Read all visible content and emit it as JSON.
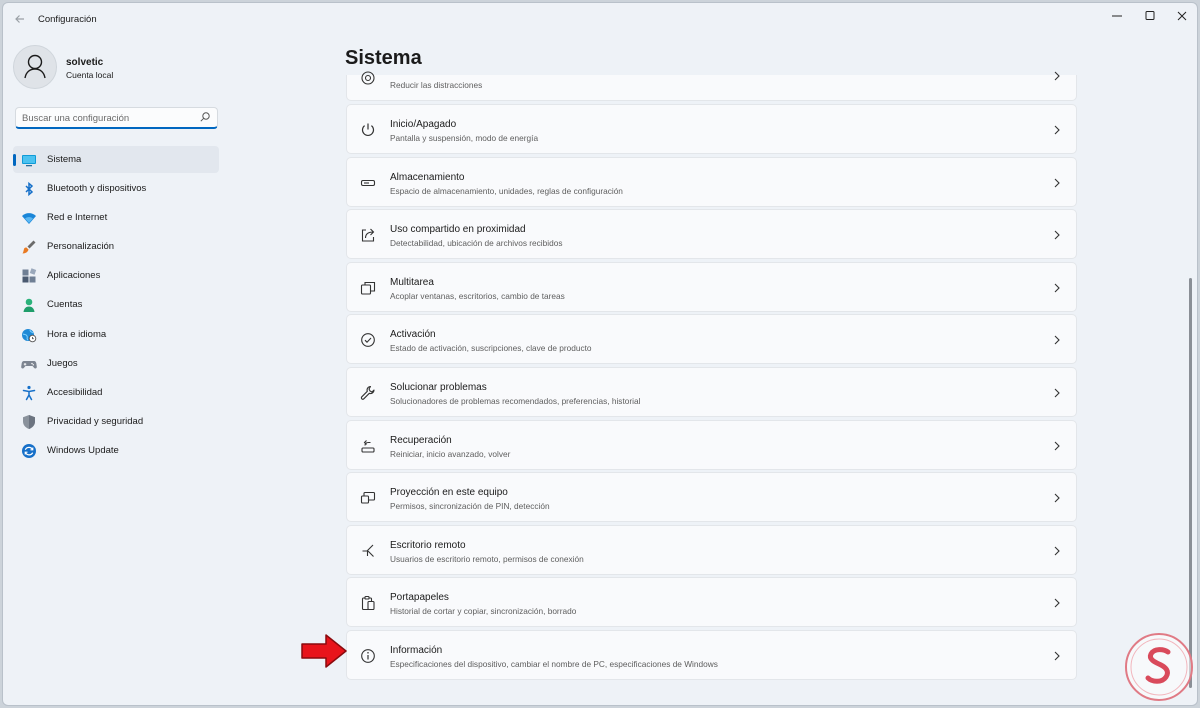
{
  "window": {
    "title": "Configuración"
  },
  "profile": {
    "name": "solvetic",
    "account_type": "Cuenta local"
  },
  "search": {
    "placeholder": "Buscar una configuración"
  },
  "sidebar": {
    "items": [
      {
        "label": "Sistema",
        "icon": "monitor-icon",
        "selected": true
      },
      {
        "label": "Bluetooth y dispositivos",
        "icon": "bluetooth-icon"
      },
      {
        "label": "Red e Internet",
        "icon": "wifi-icon"
      },
      {
        "label": "Personalización",
        "icon": "brush-icon"
      },
      {
        "label": "Aplicaciones",
        "icon": "apps-icon"
      },
      {
        "label": "Cuentas",
        "icon": "person-icon"
      },
      {
        "label": "Hora e idioma",
        "icon": "globe-clock-icon"
      },
      {
        "label": "Juegos",
        "icon": "gamepad-icon"
      },
      {
        "label": "Accesibilidad",
        "icon": "accessibility-icon"
      },
      {
        "label": "Privacidad y seguridad",
        "icon": "shield-icon"
      },
      {
        "label": "Windows Update",
        "icon": "update-icon"
      }
    ]
  },
  "main": {
    "title": "Sistema",
    "partial_item": {
      "subtitle": "Reducir las distracciones",
      "icon": "focus-icon"
    },
    "items": [
      {
        "title": "Inicio/Apagado",
        "subtitle": "Pantalla y suspensión, modo de energía",
        "icon": "power-icon"
      },
      {
        "title": "Almacenamiento",
        "subtitle": "Espacio de almacenamiento, unidades, reglas de configuración",
        "icon": "storage-icon"
      },
      {
        "title": "Uso compartido en proximidad",
        "subtitle": "Detectabilidad, ubicación de archivos recibidos",
        "icon": "share-icon"
      },
      {
        "title": "Multitarea",
        "subtitle": "Acoplar ventanas, escritorios, cambio de tareas",
        "icon": "multitask-icon"
      },
      {
        "title": "Activación",
        "subtitle": "Estado de activación, suscripciones, clave de producto",
        "icon": "check-circle-icon"
      },
      {
        "title": "Solucionar problemas",
        "subtitle": "Solucionadores de problemas recomendados, preferencias, historial",
        "icon": "wrench-icon"
      },
      {
        "title": "Recuperación",
        "subtitle": "Reiniciar, inicio avanzado, volver",
        "icon": "recovery-icon"
      },
      {
        "title": "Proyección en este equipo",
        "subtitle": "Permisos, sincronización de PIN, detección",
        "icon": "projection-icon"
      },
      {
        "title": "Escritorio remoto",
        "subtitle": "Usuarios de escritorio remoto, permisos de conexión",
        "icon": "remote-desktop-icon"
      },
      {
        "title": "Portapapeles",
        "subtitle": "Historial de cortar y copiar, sincronización, borrado",
        "icon": "clipboard-icon"
      },
      {
        "title": "Información",
        "subtitle": "Especificaciones del dispositivo, cambiar el nombre de PC, especificaciones de Windows",
        "icon": "info-icon"
      }
    ]
  },
  "colors": {
    "accent": "#0067c0",
    "background": "#eef2f7",
    "card": "#f9fafc",
    "annotation_arrow": "#e8141b"
  }
}
